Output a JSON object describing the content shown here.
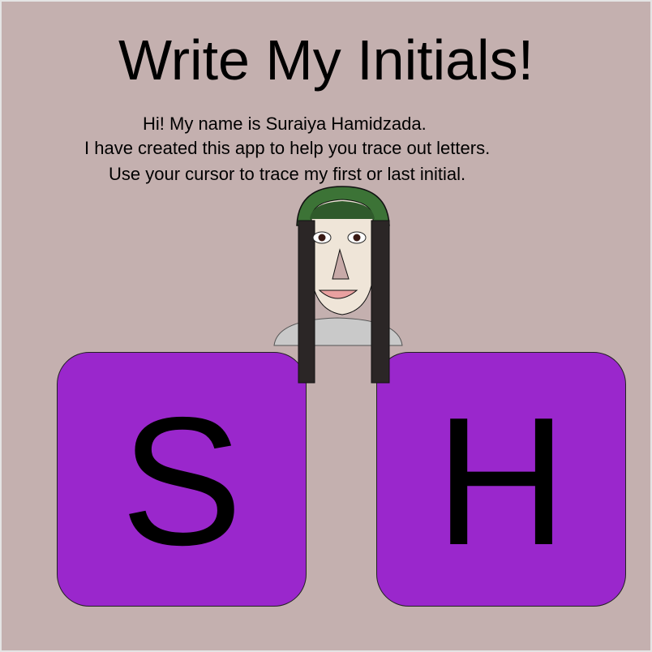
{
  "title": "Write My Initials!",
  "intro": [
    "Hi! My name is Suraiya Hamidzada.",
    "I have created this app to help you trace out letters.",
    "Use your cursor to trace my first or last initial."
  ],
  "tiles": [
    {
      "letter": "S"
    },
    {
      "letter": "H"
    }
  ],
  "colors": {
    "background": "#c4b0af",
    "tile": "#9a27cc",
    "hat": "#3c7336",
    "hair": "#2b2626",
    "face": "#efe5d8",
    "shoulders": "#c9c9c9"
  },
  "icons": {
    "portrait": "portrait-illustration"
  }
}
